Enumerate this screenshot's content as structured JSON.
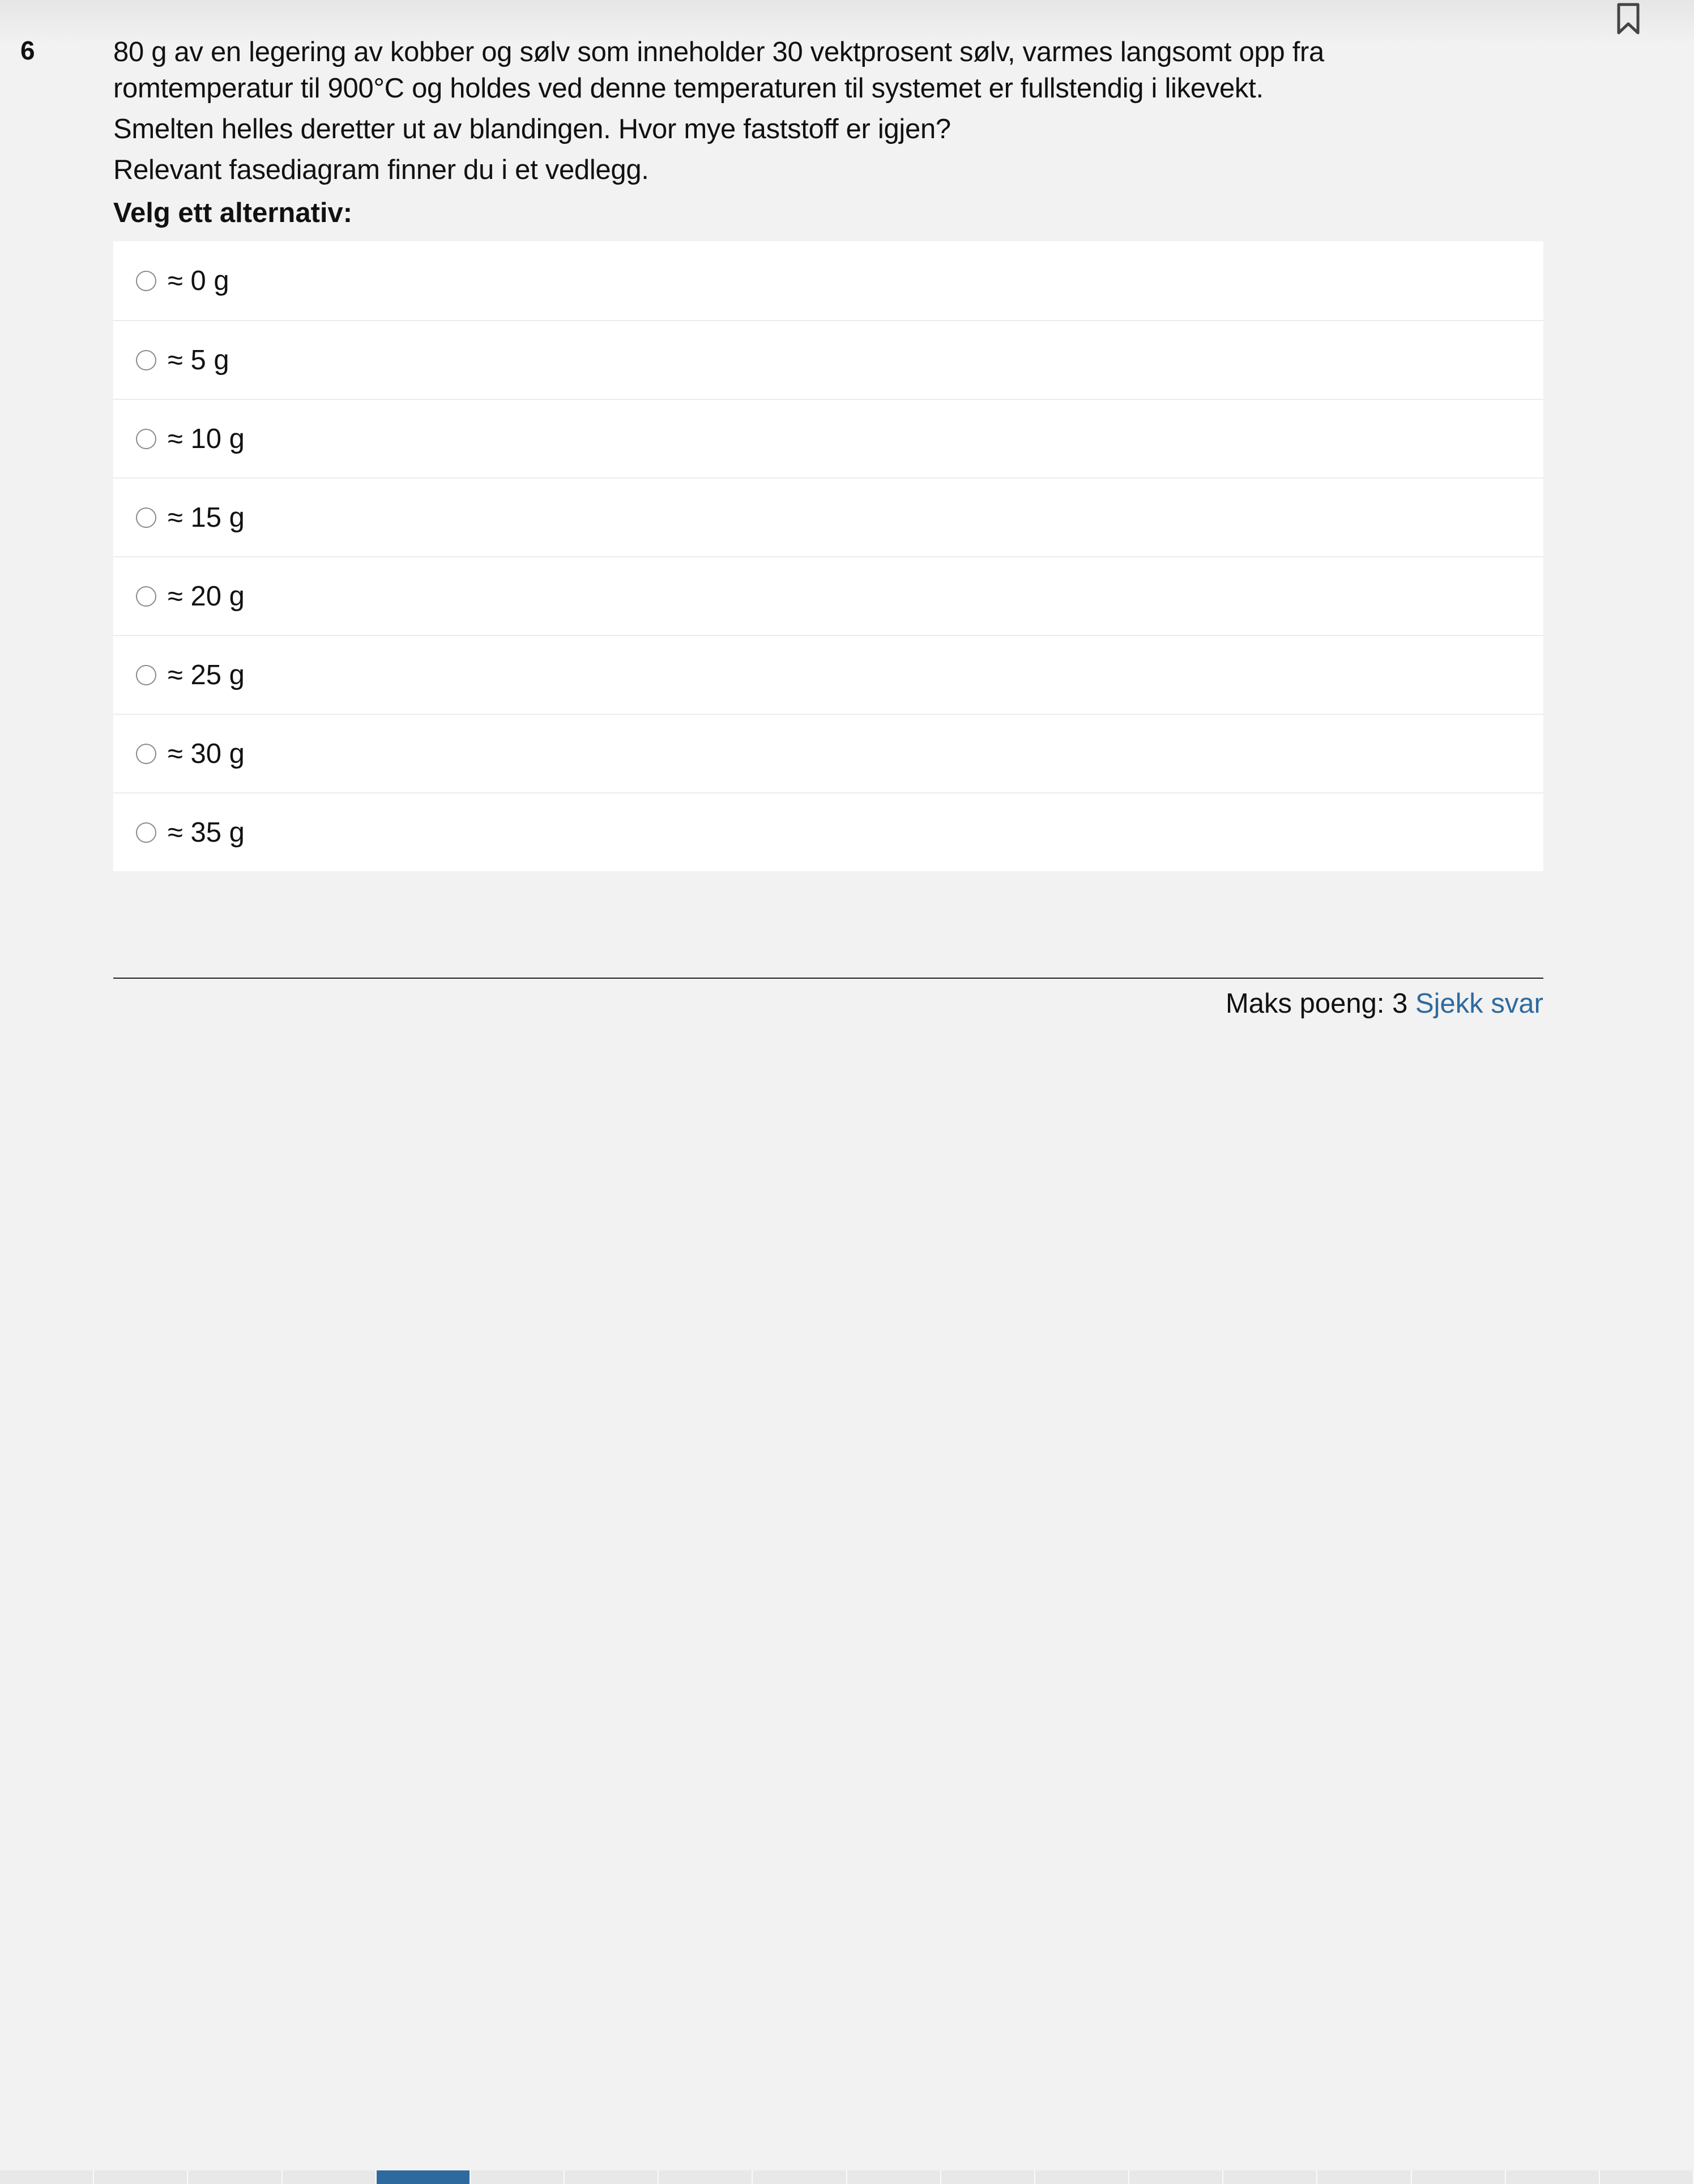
{
  "question": {
    "number": "6",
    "stem_line1": "80 g av en legering av kobber og sølv som inneholder 30 vektprosent sølv, varmes langsomt opp fra",
    "stem_line2": "romtemperatur til 900°C og holdes ved denne temperaturen til systemet er fullstendig i likevekt.",
    "stem_line3": "Smelten helles deretter ut av blandingen. Hvor mye faststoff er igjen?",
    "stem_line4": "Relevant fasediagram finner du i et vedlegg.",
    "instruction": "Velg ett alternativ:"
  },
  "options": [
    {
      "label": "≈ 0 g"
    },
    {
      "label": "≈ 5 g"
    },
    {
      "label": "≈ 10 g"
    },
    {
      "label": "≈ 15 g"
    },
    {
      "label": "≈ 20 g"
    },
    {
      "label": "≈ 25 g"
    },
    {
      "label": "≈ 30 g"
    },
    {
      "label": "≈ 35 g"
    }
  ],
  "footer": {
    "max_points": "Maks poeng: 3",
    "check_answer": "Sjekk svar"
  },
  "navigation": {
    "active_index": 4,
    "cell_count": 18
  },
  "icons": {
    "bookmark": "bookmark-icon"
  },
  "colors": {
    "link": "#2f6a9e",
    "background": "#f2f2f2"
  }
}
